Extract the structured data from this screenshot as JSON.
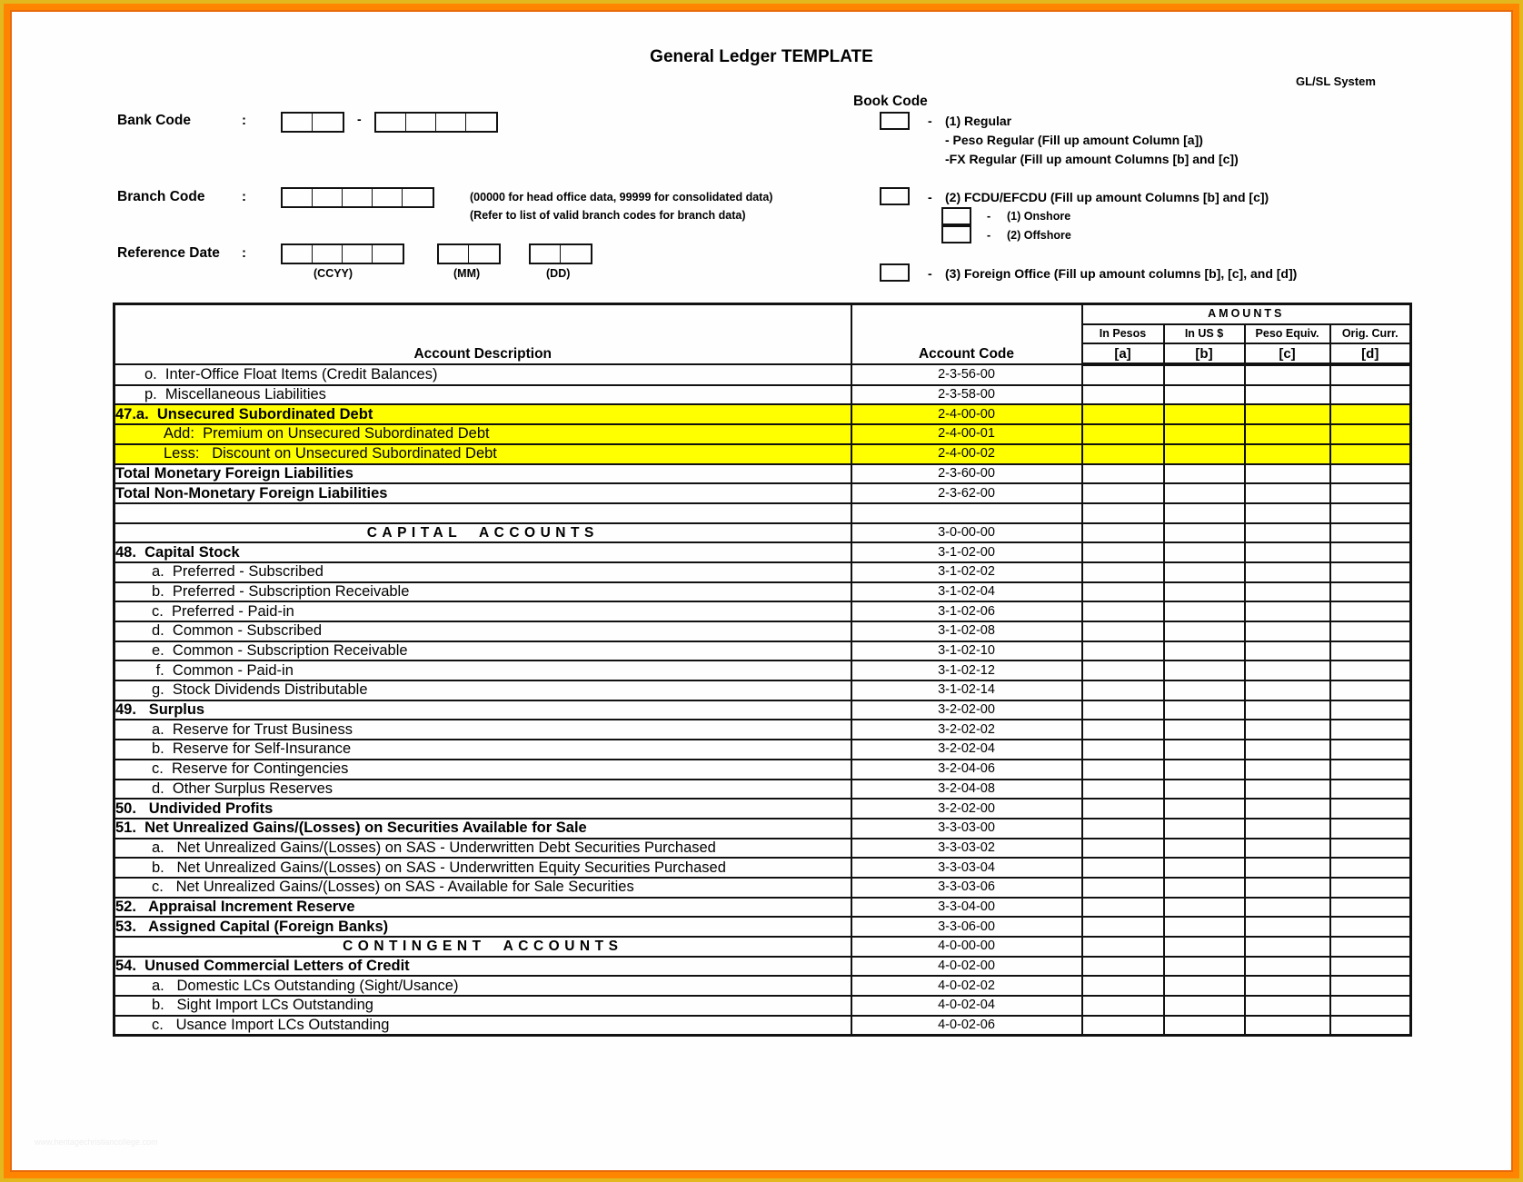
{
  "title": "General Ledger TEMPLATE",
  "system_label": "GL/SL System",
  "form": {
    "bank_code": {
      "label": "Bank Code",
      "colon": ":",
      "separator": "-"
    },
    "branch_code": {
      "label": "Branch Code",
      "colon": ":",
      "note_1": "(00000 for head office data, 99999 for consolidated data)",
      "note_2": "(Refer to list of valid branch codes for branch data)"
    },
    "reference_date": {
      "label": "Reference Date",
      "colon": ":",
      "ccyy": "(CCYY)",
      "mm": "(MM)",
      "dd": "(DD)"
    }
  },
  "book_code": {
    "label": "Book Code",
    "dash": "-",
    "regular": "(1) Regular",
    "peso_regular": "- Peso Regular (Fill up amount Column [a])",
    "fx_regular": "-FX Regular (Fill up amount Columns [b] and [c])",
    "fcdu": "(2) FCDU/EFCDU (Fill up amount Columns [b] and [c])",
    "onshore": "(1) Onshore",
    "offshore": "(2) Offshore",
    "foreign_office": "(3) Foreign Office (Fill up amount columns [b], [c], and [d])"
  },
  "table": {
    "headers": {
      "description": "Account Description",
      "code": "Account Code",
      "amounts": "AMOUNTS",
      "columns": [
        "In Pesos",
        "In US $",
        "Peso Equiv.",
        "Orig. Curr."
      ],
      "letters": [
        "[a]",
        "[b]",
        "[c]",
        "[d]"
      ]
    },
    "rows": [
      {
        "desc": "o.  Inter-Office Float Items (Credit Balances)",
        "code": "2-3-56-00",
        "style": "sub1",
        "highlight": false
      },
      {
        "desc": "p.  Miscellaneous Liabilities",
        "code": "2-3-58-00",
        "style": "sub1",
        "highlight": false
      },
      {
        "desc": "47.a.  Unsecured Subordinated Debt",
        "code": "2-4-00-00",
        "style": "bold",
        "highlight": true
      },
      {
        "desc": "Add:  Premium on Unsecured Subordinated Debt",
        "code": "2-4-00-01",
        "style": "sub2",
        "highlight": true
      },
      {
        "desc": "Less:   Discount on Unsecured Subordinated Debt",
        "code": "2-4-00-02",
        "style": "sub2",
        "highlight": true
      },
      {
        "desc": "Total Monetary Foreign Liabilities",
        "code": "2-3-60-00",
        "style": "bold",
        "highlight": false
      },
      {
        "desc": "Total Non-Monetary Foreign Liabilities",
        "code": "2-3-62-00",
        "style": "bold",
        "highlight": false
      },
      {
        "desc": "",
        "code": "",
        "style": "plain",
        "highlight": false
      },
      {
        "desc": "CAPITAL  ACCOUNTS",
        "code": "3-0-00-00",
        "style": "section",
        "highlight": false
      },
      {
        "desc": "48.  Capital Stock",
        "code": "3-1-02-00",
        "style": "bold",
        "highlight": false
      },
      {
        "desc": "a.  Preferred - Subscribed",
        "code": "3-1-02-02",
        "style": "sub3",
        "highlight": false
      },
      {
        "desc": "b.  Preferred - Subscription Receivable",
        "code": "3-1-02-04",
        "style": "sub3",
        "highlight": false
      },
      {
        "desc": "c.  Preferred - Paid-in",
        "code": "3-1-02-06",
        "style": "sub3",
        "highlight": false
      },
      {
        "desc": "d.  Common - Subscribed",
        "code": "3-1-02-08",
        "style": "sub3",
        "highlight": false
      },
      {
        "desc": "e.  Common - Subscription Receivable",
        "code": "3-1-02-10",
        "style": "sub3",
        "highlight": false
      },
      {
        "desc": " f.  Common - Paid-in",
        "code": "3-1-02-12",
        "style": "sub3",
        "highlight": false
      },
      {
        "desc": "g.  Stock Dividends Distributable",
        "code": "3-1-02-14",
        "style": "sub3",
        "highlight": false
      },
      {
        "desc": "49.   Surplus",
        "code": "3-2-02-00",
        "style": "bold",
        "highlight": false
      },
      {
        "desc": "a.  Reserve for Trust Business",
        "code": "3-2-02-02",
        "style": "sub3",
        "highlight": false
      },
      {
        "desc": "b.  Reserve for Self-Insurance",
        "code": "3-2-02-04",
        "style": "sub3",
        "highlight": false
      },
      {
        "desc": "c.  Reserve for Contingencies",
        "code": "3-2-04-06",
        "style": "sub3",
        "highlight": false
      },
      {
        "desc": "d.  Other Surplus Reserves",
        "code": "3-2-04-08",
        "style": "sub3",
        "highlight": false
      },
      {
        "desc": "50.   Undivided Profits",
        "code": "3-2-02-00",
        "style": "bold",
        "highlight": false
      },
      {
        "desc": "51.  Net Unrealized Gains/(Losses) on Securities Available for Sale",
        "code": "3-3-03-00",
        "style": "bold",
        "highlight": false
      },
      {
        "desc": "a.   Net Unrealized Gains/(Losses) on SAS - Underwritten Debt Securities Purchased",
        "code": "3-3-03-02",
        "style": "sub3",
        "highlight": false
      },
      {
        "desc": "b.   Net Unrealized Gains/(Losses) on SAS - Underwritten Equity Securities Purchased",
        "code": "3-3-03-04",
        "style": "sub3",
        "highlight": false
      },
      {
        "desc": "c.   Net Unrealized Gains/(Losses) on SAS - Available for Sale Securities",
        "code": "3-3-03-06",
        "style": "sub3",
        "highlight": false
      },
      {
        "desc": "52.   Appraisal Increment Reserve",
        "code": "3-3-04-00",
        "style": "bold",
        "highlight": false
      },
      {
        "desc": "53.   Assigned Capital (Foreign Banks)",
        "code": "3-3-06-00",
        "style": "bold",
        "highlight": false
      },
      {
        "desc": "CONTINGENT  ACCOUNTS",
        "code": "4-0-00-00",
        "style": "section",
        "highlight": false
      },
      {
        "desc": "54.  Unused Commercial Letters of Credit",
        "code": "4-0-02-00",
        "style": "bold",
        "highlight": false
      },
      {
        "desc": "a.   Domestic LCs Outstanding (Sight/Usance)",
        "code": "4-0-02-02",
        "style": "sub3",
        "highlight": false
      },
      {
        "desc": "b.   Sight Import LCs Outstanding",
        "code": "4-0-02-04",
        "style": "sub3",
        "highlight": false
      },
      {
        "desc": "c.   Usance Import LCs Outstanding",
        "code": "4-0-02-06",
        "style": "sub3",
        "highlight": false
      }
    ]
  },
  "colors": {
    "highlight": "#ffff00",
    "frame_orange": "#ff8400",
    "frame_gold": "#e3b81f"
  },
  "watermark": "www.heritagechristiancollege.com"
}
